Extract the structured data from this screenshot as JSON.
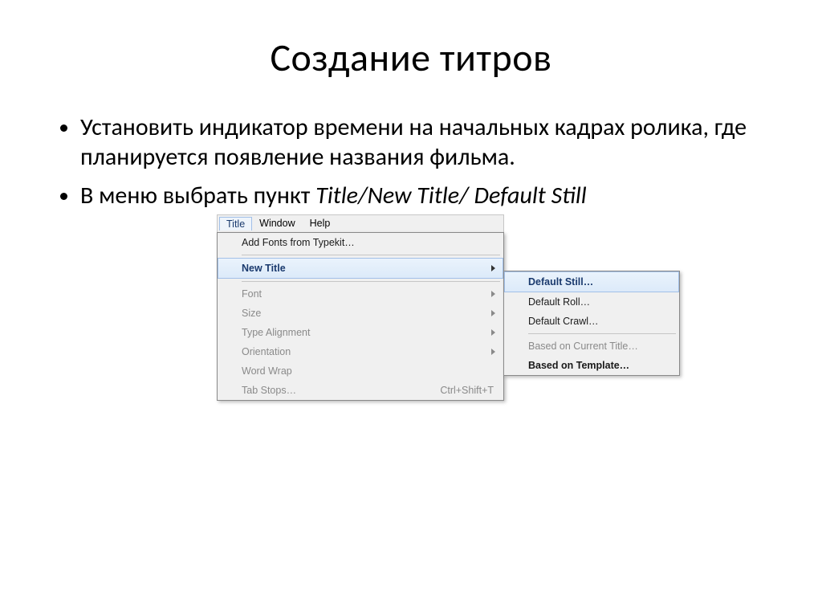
{
  "slide": {
    "title": "Создание титров",
    "bullets": [
      {
        "text": "Установить индикатор времени на начальных кадрах ролика, где планируется появление названия фильма."
      },
      {
        "prefix": "В меню выбрать пункт ",
        "italic": "Title/New Title/ Default Still"
      }
    ]
  },
  "menu": {
    "bar": {
      "title": "Title",
      "window": "Window",
      "help": "Help"
    },
    "items": {
      "addFonts": "Add Fonts from Typekit…",
      "newTitle": "New Title",
      "font": "Font",
      "size": "Size",
      "typeAlignment": "Type Alignment",
      "orientation": "Orientation",
      "wordWrap": "Word Wrap",
      "tabStops": {
        "label": "Tab Stops…",
        "shortcut": "Ctrl+Shift+T"
      }
    },
    "submenu": {
      "defaultStill": "Default Still…",
      "defaultRoll": "Default Roll…",
      "defaultCrawl": "Default Crawl…",
      "basedCurrent": "Based on Current Title…",
      "basedTemplate": "Based on Template…"
    }
  }
}
